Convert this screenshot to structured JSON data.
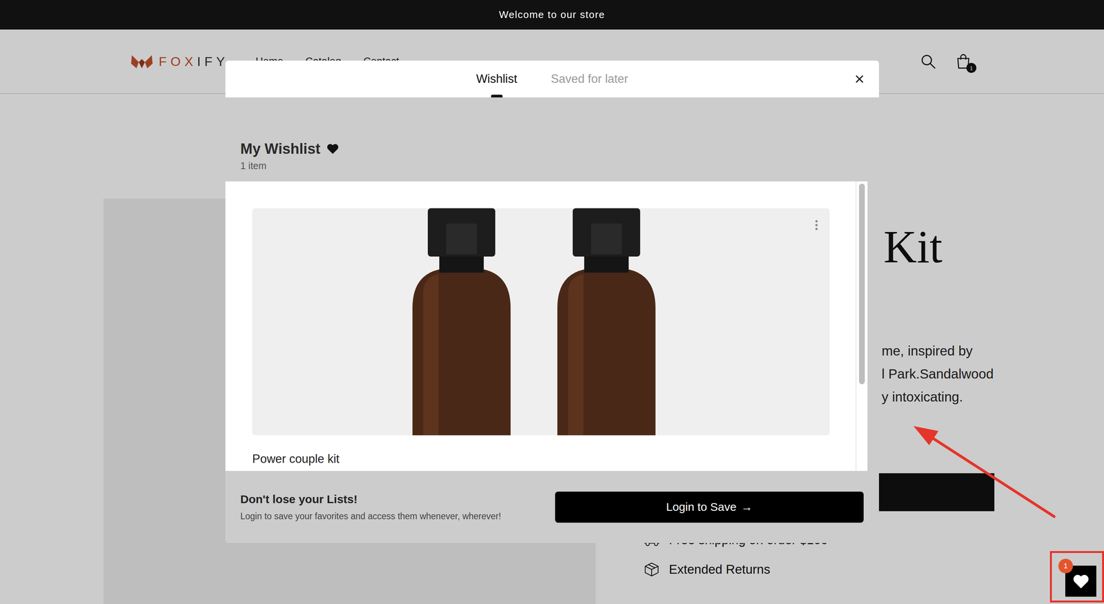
{
  "announcement": "Welcome to our store",
  "header": {
    "logo": [
      "FOX",
      "IFY"
    ],
    "nav": [
      "Home",
      "Catalog",
      "Contact"
    ],
    "cart_count": "1"
  },
  "product": {
    "title": "Kit",
    "description": [
      "me, inspired by",
      "l Park.Sandalwood",
      "y intoxicating."
    ],
    "features": [
      "Free shipping on order $100",
      "Extended Returns"
    ]
  },
  "modal": {
    "tabs": [
      {
        "label": "Wishlist",
        "selected": true
      },
      {
        "label": "Saved for later",
        "selected": false
      }
    ],
    "close": "×",
    "list_title": "My Wishlist",
    "count": "1 item",
    "items": [
      {
        "name": "Power couple kit"
      }
    ],
    "footer": {
      "title": "Don't lose your Lists!",
      "text": "Login to save your favorites and access them whenever, wherever!",
      "button": "Login to Save",
      "button_icon": "→"
    }
  },
  "floating_button": {
    "badge": "1"
  }
}
